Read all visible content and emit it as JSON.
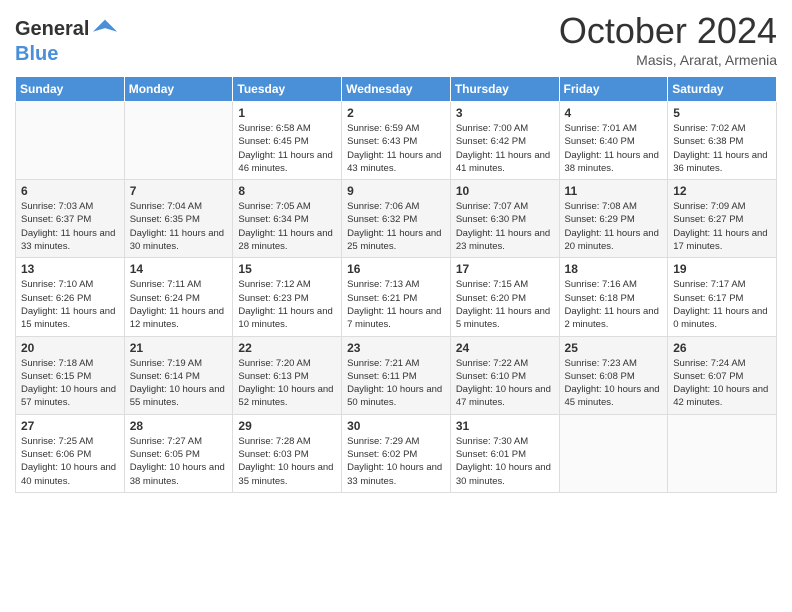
{
  "logo": {
    "line1": "General",
    "line2": "Blue"
  },
  "title": "October 2024",
  "subtitle": "Masis, Ararat, Armenia",
  "days_of_week": [
    "Sunday",
    "Monday",
    "Tuesday",
    "Wednesday",
    "Thursday",
    "Friday",
    "Saturday"
  ],
  "weeks": [
    [
      {
        "day": "",
        "sunrise": "",
        "sunset": "",
        "daylight": ""
      },
      {
        "day": "",
        "sunrise": "",
        "sunset": "",
        "daylight": ""
      },
      {
        "day": "1",
        "sunrise": "Sunrise: 6:58 AM",
        "sunset": "Sunset: 6:45 PM",
        "daylight": "Daylight: 11 hours and 46 minutes."
      },
      {
        "day": "2",
        "sunrise": "Sunrise: 6:59 AM",
        "sunset": "Sunset: 6:43 PM",
        "daylight": "Daylight: 11 hours and 43 minutes."
      },
      {
        "day": "3",
        "sunrise": "Sunrise: 7:00 AM",
        "sunset": "Sunset: 6:42 PM",
        "daylight": "Daylight: 11 hours and 41 minutes."
      },
      {
        "day": "4",
        "sunrise": "Sunrise: 7:01 AM",
        "sunset": "Sunset: 6:40 PM",
        "daylight": "Daylight: 11 hours and 38 minutes."
      },
      {
        "day": "5",
        "sunrise": "Sunrise: 7:02 AM",
        "sunset": "Sunset: 6:38 PM",
        "daylight": "Daylight: 11 hours and 36 minutes."
      }
    ],
    [
      {
        "day": "6",
        "sunrise": "Sunrise: 7:03 AM",
        "sunset": "Sunset: 6:37 PM",
        "daylight": "Daylight: 11 hours and 33 minutes."
      },
      {
        "day": "7",
        "sunrise": "Sunrise: 7:04 AM",
        "sunset": "Sunset: 6:35 PM",
        "daylight": "Daylight: 11 hours and 30 minutes."
      },
      {
        "day": "8",
        "sunrise": "Sunrise: 7:05 AM",
        "sunset": "Sunset: 6:34 PM",
        "daylight": "Daylight: 11 hours and 28 minutes."
      },
      {
        "day": "9",
        "sunrise": "Sunrise: 7:06 AM",
        "sunset": "Sunset: 6:32 PM",
        "daylight": "Daylight: 11 hours and 25 minutes."
      },
      {
        "day": "10",
        "sunrise": "Sunrise: 7:07 AM",
        "sunset": "Sunset: 6:30 PM",
        "daylight": "Daylight: 11 hours and 23 minutes."
      },
      {
        "day": "11",
        "sunrise": "Sunrise: 7:08 AM",
        "sunset": "Sunset: 6:29 PM",
        "daylight": "Daylight: 11 hours and 20 minutes."
      },
      {
        "day": "12",
        "sunrise": "Sunrise: 7:09 AM",
        "sunset": "Sunset: 6:27 PM",
        "daylight": "Daylight: 11 hours and 17 minutes."
      }
    ],
    [
      {
        "day": "13",
        "sunrise": "Sunrise: 7:10 AM",
        "sunset": "Sunset: 6:26 PM",
        "daylight": "Daylight: 11 hours and 15 minutes."
      },
      {
        "day": "14",
        "sunrise": "Sunrise: 7:11 AM",
        "sunset": "Sunset: 6:24 PM",
        "daylight": "Daylight: 11 hours and 12 minutes."
      },
      {
        "day": "15",
        "sunrise": "Sunrise: 7:12 AM",
        "sunset": "Sunset: 6:23 PM",
        "daylight": "Daylight: 11 hours and 10 minutes."
      },
      {
        "day": "16",
        "sunrise": "Sunrise: 7:13 AM",
        "sunset": "Sunset: 6:21 PM",
        "daylight": "Daylight: 11 hours and 7 minutes."
      },
      {
        "day": "17",
        "sunrise": "Sunrise: 7:15 AM",
        "sunset": "Sunset: 6:20 PM",
        "daylight": "Daylight: 11 hours and 5 minutes."
      },
      {
        "day": "18",
        "sunrise": "Sunrise: 7:16 AM",
        "sunset": "Sunset: 6:18 PM",
        "daylight": "Daylight: 11 hours and 2 minutes."
      },
      {
        "day": "19",
        "sunrise": "Sunrise: 7:17 AM",
        "sunset": "Sunset: 6:17 PM",
        "daylight": "Daylight: 11 hours and 0 minutes."
      }
    ],
    [
      {
        "day": "20",
        "sunrise": "Sunrise: 7:18 AM",
        "sunset": "Sunset: 6:15 PM",
        "daylight": "Daylight: 10 hours and 57 minutes."
      },
      {
        "day": "21",
        "sunrise": "Sunrise: 7:19 AM",
        "sunset": "Sunset: 6:14 PM",
        "daylight": "Daylight: 10 hours and 55 minutes."
      },
      {
        "day": "22",
        "sunrise": "Sunrise: 7:20 AM",
        "sunset": "Sunset: 6:13 PM",
        "daylight": "Daylight: 10 hours and 52 minutes."
      },
      {
        "day": "23",
        "sunrise": "Sunrise: 7:21 AM",
        "sunset": "Sunset: 6:11 PM",
        "daylight": "Daylight: 10 hours and 50 minutes."
      },
      {
        "day": "24",
        "sunrise": "Sunrise: 7:22 AM",
        "sunset": "Sunset: 6:10 PM",
        "daylight": "Daylight: 10 hours and 47 minutes."
      },
      {
        "day": "25",
        "sunrise": "Sunrise: 7:23 AM",
        "sunset": "Sunset: 6:08 PM",
        "daylight": "Daylight: 10 hours and 45 minutes."
      },
      {
        "day": "26",
        "sunrise": "Sunrise: 7:24 AM",
        "sunset": "Sunset: 6:07 PM",
        "daylight": "Daylight: 10 hours and 42 minutes."
      }
    ],
    [
      {
        "day": "27",
        "sunrise": "Sunrise: 7:25 AM",
        "sunset": "Sunset: 6:06 PM",
        "daylight": "Daylight: 10 hours and 40 minutes."
      },
      {
        "day": "28",
        "sunrise": "Sunrise: 7:27 AM",
        "sunset": "Sunset: 6:05 PM",
        "daylight": "Daylight: 10 hours and 38 minutes."
      },
      {
        "day": "29",
        "sunrise": "Sunrise: 7:28 AM",
        "sunset": "Sunset: 6:03 PM",
        "daylight": "Daylight: 10 hours and 35 minutes."
      },
      {
        "day": "30",
        "sunrise": "Sunrise: 7:29 AM",
        "sunset": "Sunset: 6:02 PM",
        "daylight": "Daylight: 10 hours and 33 minutes."
      },
      {
        "day": "31",
        "sunrise": "Sunrise: 7:30 AM",
        "sunset": "Sunset: 6:01 PM",
        "daylight": "Daylight: 10 hours and 30 minutes."
      },
      {
        "day": "",
        "sunrise": "",
        "sunset": "",
        "daylight": ""
      },
      {
        "day": "",
        "sunrise": "",
        "sunset": "",
        "daylight": ""
      }
    ]
  ]
}
